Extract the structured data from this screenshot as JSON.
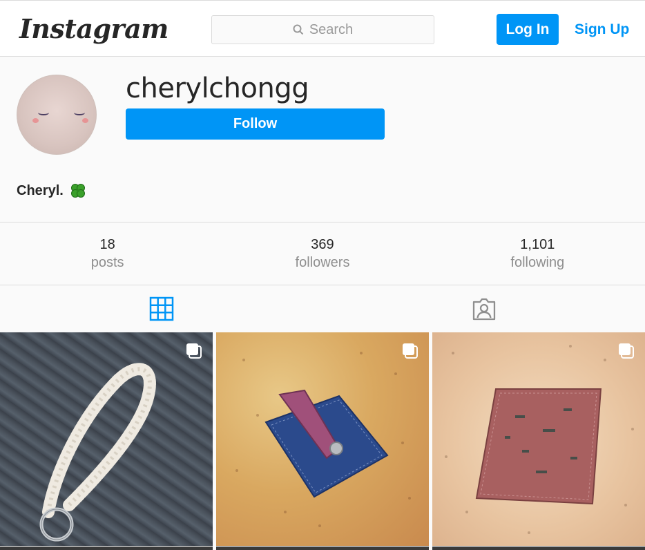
{
  "header": {
    "logo_text": "Instagram",
    "search_placeholder": "Search",
    "login_label": "Log In",
    "signup_label": "Sign Up"
  },
  "profile": {
    "username": "cherylchongg",
    "follow_label": "Follow",
    "bio": "Cheryl.",
    "bio_emoji": "four-leaf-clover"
  },
  "stats": [
    {
      "value": "18",
      "label": "posts"
    },
    {
      "value": "369",
      "label": "followers"
    },
    {
      "value": "1,101",
      "label": "following"
    }
  ],
  "tabs": [
    {
      "icon": "grid-icon",
      "active": true
    },
    {
      "icon": "tagged-icon",
      "active": false
    }
  ],
  "posts": [
    {
      "subject": "macrame keychain",
      "multi": true
    },
    {
      "subject": "cork card holder",
      "multi": true
    },
    {
      "subject": "cork wallet",
      "multi": true
    }
  ],
  "colors": {
    "accent": "#0095f6",
    "text": "#262626",
    "muted": "#8e8e8e",
    "border": "#dbdbdb",
    "background": "#fafafa"
  }
}
